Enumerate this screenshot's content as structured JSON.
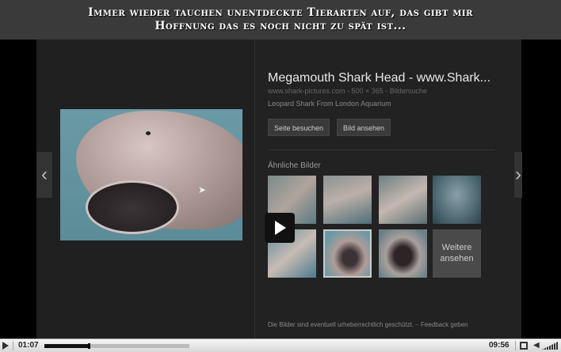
{
  "caption": {
    "line1": "Immer wieder tauchen unentdeckte Tierarten auf, das gibt mir",
    "line2": "Hoffnung das es noch nicht zu spät ist..."
  },
  "result": {
    "title": "Megamouth Shark Head - www.Shark...",
    "meta": "www.shark-pictures.com - 500 × 365 - Bildersuche",
    "description": "Leopard Shark From London Aquarium",
    "visit_button": "Seite besuchen",
    "view_button": "Bild ansehen"
  },
  "similar": {
    "label": "Ähnliche Bilder",
    "more_label": "Weitere ansehen"
  },
  "footer": {
    "notice": "Die Bilder sind eventuell urheberrechtlich geschützt.",
    "feedback": "Feedback geben"
  },
  "player": {
    "current_time": "01:07",
    "duration": "09:56",
    "progress_fraction": 0.306
  },
  "icons": [
    "play-icon",
    "fullscreen-icon",
    "volume-icon",
    "chevron-left-icon",
    "chevron-right-icon"
  ]
}
